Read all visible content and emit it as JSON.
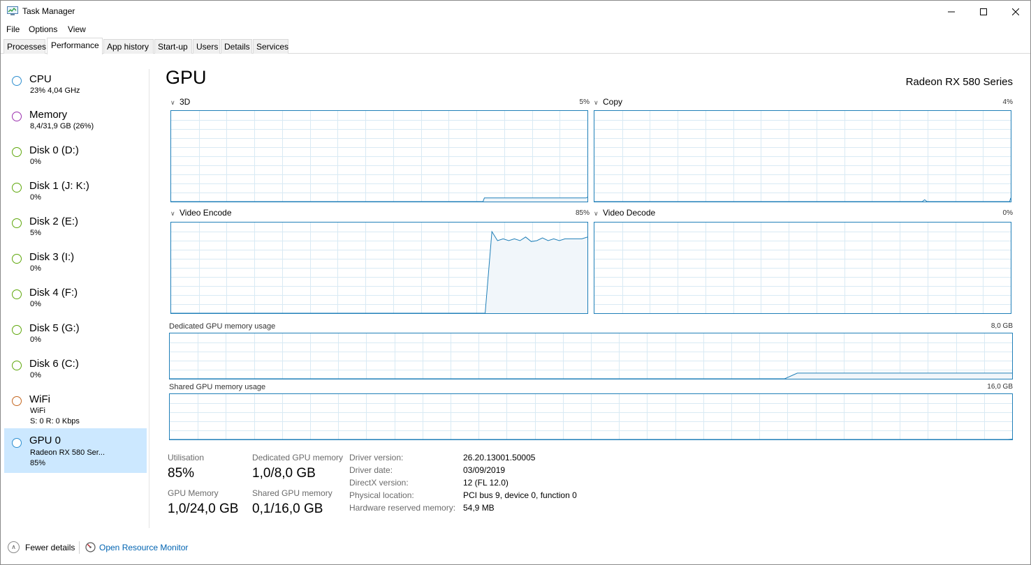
{
  "window": {
    "title": "Task Manager"
  },
  "menu": [
    "File",
    "Options",
    "View"
  ],
  "tabs": [
    "Processes",
    "Performance",
    "App history",
    "Start-up",
    "Users",
    "Details",
    "Services"
  ],
  "sidebar": {
    "items": [
      {
        "title": "CPU",
        "sub1": "23%  4,04 GHz",
        "sub2": "",
        "color": "#2d8ecf"
      },
      {
        "title": "Memory",
        "sub1": "8,4/31,9 GB (26%)",
        "sub2": "",
        "color": "#9b2fae"
      },
      {
        "title": "Disk 0 (D:)",
        "sub1": "0%",
        "sub2": "",
        "color": "#5ea70a"
      },
      {
        "title": "Disk 1 (J: K:)",
        "sub1": "0%",
        "sub2": "",
        "color": "#5ea70a"
      },
      {
        "title": "Disk 2 (E:)",
        "sub1": "5%",
        "sub2": "",
        "color": "#5ea70a"
      },
      {
        "title": "Disk 3 (I:)",
        "sub1": "0%",
        "sub2": "",
        "color": "#5ea70a"
      },
      {
        "title": "Disk 4 (F:)",
        "sub1": "0%",
        "sub2": "",
        "color": "#5ea70a"
      },
      {
        "title": "Disk 5 (G:)",
        "sub1": "0%",
        "sub2": "",
        "color": "#5ea70a"
      },
      {
        "title": "Disk 6 (C:)",
        "sub1": "0%",
        "sub2": "",
        "color": "#5ea70a"
      },
      {
        "title": "WiFi",
        "sub1": "WiFi",
        "sub2": "S: 0  R: 0 Kbps",
        "color": "#c4661f"
      },
      {
        "title": "GPU 0",
        "sub1": "Radeon RX 580 Ser...",
        "sub2": "85%",
        "color": "#2d8ecf",
        "selected": true
      }
    ]
  },
  "gpu": {
    "title": "GPU",
    "model": "Radeon RX 580 Series",
    "engines": [
      {
        "name": "3D",
        "percent": "5%",
        "series": [
          0,
          0,
          0,
          0,
          0,
          0,
          0,
          0,
          0,
          0,
          0,
          0,
          0,
          0,
          0,
          0,
          0,
          0,
          0,
          0,
          0,
          0,
          0,
          0,
          0,
          0,
          0,
          0,
          0,
          0,
          0,
          0,
          0,
          0,
          0,
          0,
          0,
          0,
          0,
          0,
          0,
          0,
          0,
          0,
          0,
          0,
          0,
          0,
          0,
          0,
          0,
          0,
          0,
          0,
          0,
          0,
          0,
          0,
          0,
          0,
          0,
          0,
          0,
          0,
          0,
          0,
          0,
          0,
          0,
          0,
          0,
          0,
          0,
          0,
          0,
          0,
          0,
          0,
          0,
          0,
          0,
          0,
          0,
          0,
          0,
          0,
          0,
          0,
          0,
          0,
          0,
          0,
          0,
          0,
          0,
          0,
          0,
          0,
          0,
          0,
          0,
          0,
          0,
          0,
          0,
          0,
          0,
          0,
          0,
          0,
          0,
          0,
          0,
          0,
          0,
          0,
          0,
          0,
          0,
          0,
          0,
          0,
          0,
          0,
          0,
          0,
          0,
          0,
          0,
          0,
          0,
          0,
          0,
          0,
          0,
          0,
          0,
          0,
          0,
          0,
          0,
          0,
          0,
          0,
          0,
          0,
          0,
          0,
          0,
          0,
          0,
          0,
          0,
          0,
          0,
          0,
          0,
          0,
          0,
          0,
          0,
          0,
          0,
          0,
          0,
          0,
          0,
          0,
          0,
          0,
          0,
          0,
          0,
          0,
          0,
          0,
          0,
          0,
          0,
          0,
          0,
          0,
          0,
          0,
          0,
          0,
          0,
          0,
          0,
          0,
          0,
          0,
          0,
          0,
          0,
          0,
          0,
          0,
          0,
          0,
          0,
          0,
          0,
          0,
          0,
          0,
          0,
          0,
          0,
          0,
          0,
          0,
          0,
          0,
          0,
          0,
          0,
          0,
          0,
          0,
          0,
          0,
          0,
          0,
          0,
          0,
          0,
          0,
          0,
          0,
          0,
          0,
          0,
          0,
          0,
          0,
          0,
          0,
          0,
          0,
          4,
          4,
          4,
          4,
          4,
          4,
          4,
          4,
          4,
          4,
          4,
          4,
          4,
          4,
          4,
          4,
          4,
          4,
          4,
          4,
          4,
          4,
          4,
          4,
          4,
          4,
          4,
          4,
          4,
          4,
          4,
          4,
          4,
          4,
          4,
          4,
          4,
          4,
          4,
          4,
          4,
          4,
          4,
          4,
          4,
          4,
          4,
          4,
          4,
          4,
          4,
          4,
          4,
          4,
          4,
          4,
          4,
          4,
          4,
          4,
          4,
          4,
          4,
          4,
          4,
          4,
          4,
          4,
          4,
          4,
          4,
          4,
          4,
          4,
          4,
          4,
          4,
          4,
          4,
          5
        ]
      },
      {
        "name": "Copy",
        "percent": "4%",
        "series": [
          0,
          0,
          0,
          0,
          0,
          0,
          0,
          0,
          0,
          0,
          0,
          0,
          0,
          0,
          0,
          0,
          0,
          0,
          0,
          0,
          0,
          0,
          0,
          0,
          0,
          0,
          0,
          0,
          0,
          0,
          0,
          0,
          0,
          0,
          0,
          0,
          0,
          0,
          0,
          0,
          0,
          0,
          0,
          0,
          0,
          0,
          0,
          0,
          0,
          0,
          0,
          0,
          0,
          0,
          0,
          0,
          0,
          0,
          0,
          0,
          0,
          0,
          0,
          0,
          0,
          0,
          0,
          0,
          0,
          0,
          0,
          0,
          0,
          0,
          0,
          0,
          0,
          0,
          0,
          0,
          0,
          0,
          0,
          0,
          0,
          0,
          0,
          0,
          0,
          0,
          0,
          0,
          0,
          0,
          0,
          0,
          0,
          0,
          0,
          0,
          0,
          0,
          0,
          0,
          0,
          0,
          0,
          0,
          0,
          0,
          0,
          0,
          0,
          0,
          0,
          0,
          0,
          0,
          0,
          0,
          0,
          0,
          0,
          0,
          0,
          0,
          0,
          0,
          0,
          0,
          0,
          0,
          0,
          0,
          0,
          0,
          0,
          0,
          0,
          0,
          0,
          0,
          0,
          0,
          0,
          0,
          0,
          0,
          0,
          0,
          0,
          0,
          0,
          0,
          0,
          0,
          0,
          0,
          0,
          0,
          0,
          0,
          0,
          0,
          0,
          0,
          0,
          0,
          0,
          0,
          0,
          0,
          0,
          0,
          0,
          0,
          0,
          0,
          0,
          0,
          0,
          0,
          0,
          0,
          0,
          0,
          0,
          0,
          0,
          0,
          0,
          0,
          0,
          0,
          0,
          0,
          0,
          0,
          0,
          0,
          0,
          0,
          0,
          0,
          0,
          0,
          0,
          0,
          0,
          0,
          0,
          0,
          0,
          0,
          0,
          0,
          0,
          0,
          0,
          0,
          0,
          0,
          0,
          0,
          0,
          0,
          0,
          0,
          0,
          0,
          0,
          0,
          0,
          0,
          0,
          0,
          0,
          0,
          0,
          0,
          0,
          0,
          0,
          0,
          0,
          0,
          0,
          0,
          0,
          0,
          0,
          0,
          0,
          0,
          0,
          0,
          0,
          0,
          0,
          0,
          0,
          0,
          0,
          0,
          0,
          0,
          0,
          0,
          0,
          0,
          0,
          0,
          0,
          0,
          0,
          0,
          0,
          0,
          0,
          1,
          2,
          1,
          0,
          0,
          0,
          0,
          0,
          0,
          0,
          0,
          0,
          0,
          0,
          0,
          0,
          0,
          0,
          0,
          0,
          0,
          0,
          0,
          0,
          0,
          0,
          0,
          0,
          0,
          0,
          0,
          0,
          0,
          0,
          0,
          0,
          0,
          0,
          0,
          0,
          0,
          0,
          0,
          0,
          0,
          0,
          0,
          0,
          0,
          0,
          0,
          0,
          0,
          0,
          0,
          0,
          0,
          0,
          0,
          0,
          0,
          0,
          0,
          0,
          0,
          0,
          0,
          0,
          0,
          0,
          0,
          0,
          0,
          0,
          4
        ]
      },
      {
        "name": "Video Encode",
        "percent": "85%",
        "series": []
      },
      {
        "name": "Video Decode",
        "percent": "0%",
        "series": []
      }
    ],
    "encode_points": [
      [
        0,
        0
      ],
      [
        0.9,
        0
      ],
      [
        1.5,
        90
      ],
      [
        2,
        80
      ],
      [
        2.5,
        82
      ],
      [
        3,
        80
      ],
      [
        3.5,
        82
      ],
      [
        4,
        80
      ],
      [
        4.5,
        84
      ],
      [
        5,
        79
      ],
      [
        5.5,
        80
      ],
      [
        6,
        83
      ],
      [
        6.5,
        80
      ],
      [
        7,
        82
      ],
      [
        7.5,
        80
      ],
      [
        8,
        82
      ],
      [
        8.5,
        82
      ],
      [
        9,
        82
      ],
      [
        9.5,
        82
      ],
      [
        10,
        84
      ]
    ],
    "dedicated_label": "Dedicated GPU memory usage",
    "dedicated_max": "8,0 GB",
    "dedicated_level": 0.125,
    "shared_label": "Shared GPU memory usage",
    "shared_max": "16,0 GB",
    "shared_level": 0.006,
    "stats": {
      "utilisation_label": "Utilisation",
      "utilisation_value": "85%",
      "dedicated_label": "Dedicated GPU memory",
      "dedicated_value": "1,0/8,0 GB",
      "gpu_memory_label": "GPU Memory",
      "gpu_memory_value": "1,0/24,0 GB",
      "shared_label": "Shared GPU memory",
      "shared_value": "0,1/16,0 GB"
    },
    "info": [
      {
        "key": "Driver version:",
        "value": "26.20.13001.50005"
      },
      {
        "key": "Driver date:",
        "value": "03/09/2019"
      },
      {
        "key": "DirectX version:",
        "value": "12 (FL 12.0)"
      },
      {
        "key": "Physical location:",
        "value": "PCI bus 9, device 0, function 0"
      },
      {
        "key": "Hardware reserved memory:",
        "value": "54,9 MB"
      }
    ]
  },
  "footer": {
    "fewer_details": "Fewer details",
    "open_resource_monitor": "Open Resource Monitor"
  },
  "colors": {
    "graph_line": "#1f7fb8",
    "grid": "#d9eaf4",
    "fill": "#f1f6fa",
    "selected_bg": "#cce8ff"
  }
}
